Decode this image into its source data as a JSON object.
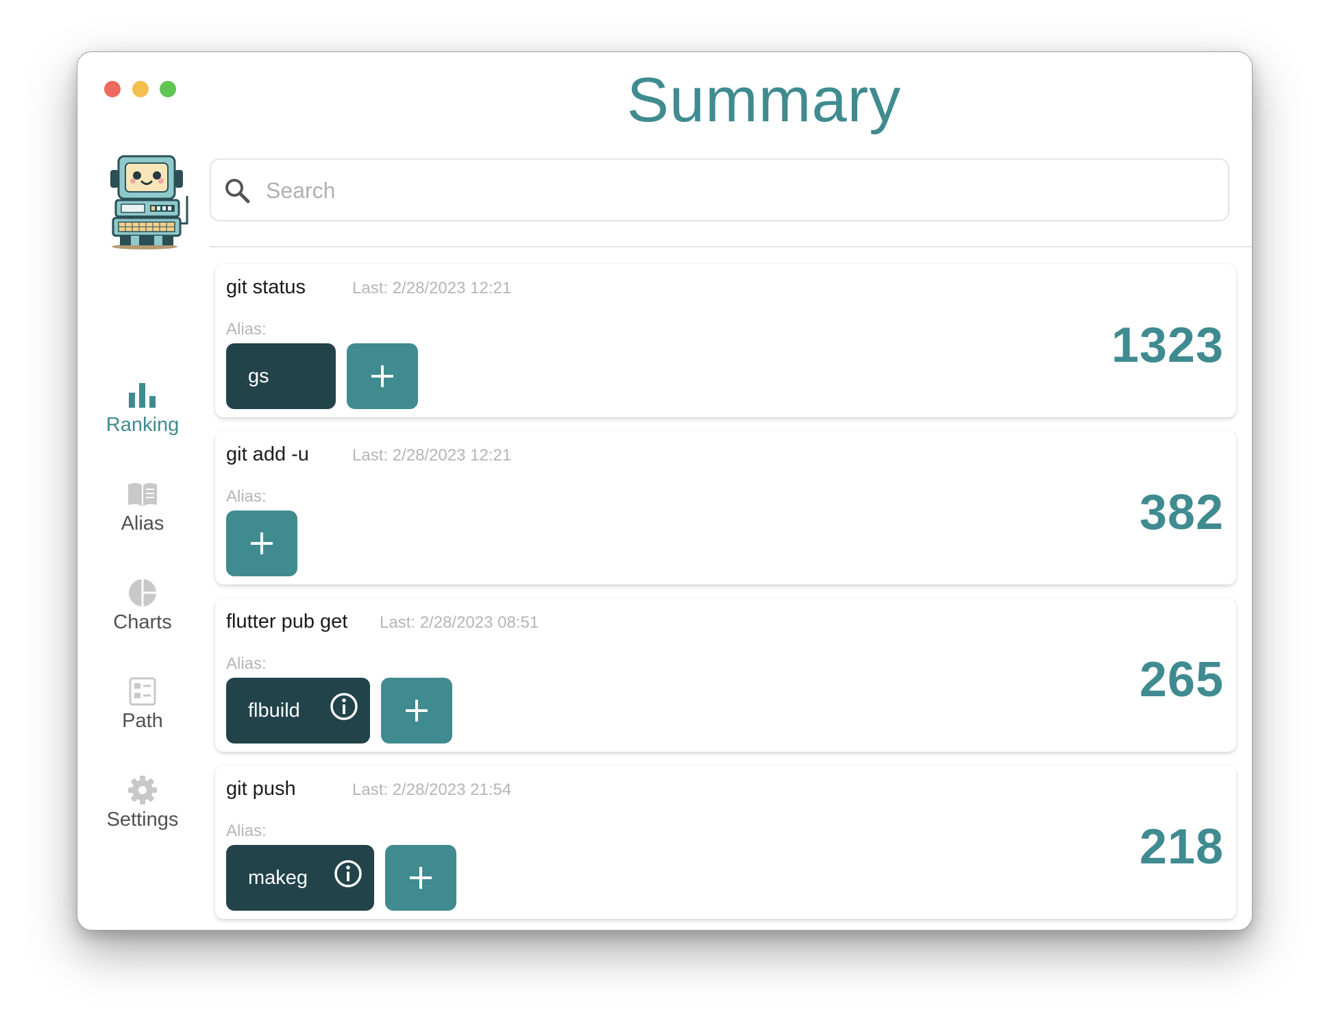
{
  "window": {
    "title": "Summary"
  },
  "sidebar": {
    "items": [
      {
        "label": "Ranking",
        "icon": "bar-chart-icon",
        "active": true
      },
      {
        "label": "Alias",
        "icon": "book-icon",
        "active": false
      },
      {
        "label": "Charts",
        "icon": "pie-chart-icon",
        "active": false
      },
      {
        "label": "Path",
        "icon": "list-panel-icon",
        "active": false
      },
      {
        "label": "Settings",
        "icon": "gear-icon",
        "active": false
      }
    ]
  },
  "search": {
    "placeholder": "Search",
    "value": ""
  },
  "commands": [
    {
      "command": "git status",
      "last": "Last: 2/28/2023 12:21",
      "alias_label": "Alias:",
      "aliases": [
        {
          "name": "gs",
          "info": false
        }
      ],
      "count": "1323"
    },
    {
      "command": "git add -u",
      "last": "Last: 2/28/2023 12:21",
      "alias_label": "Alias:",
      "aliases": [],
      "count": "382"
    },
    {
      "command": "flutter pub get",
      "last": "Last: 2/28/2023 08:51",
      "alias_label": "Alias:",
      "aliases": [
        {
          "name": "flbuild",
          "info": true
        }
      ],
      "count": "265"
    },
    {
      "command": "git push",
      "last": "Last: 2/28/2023 21:54",
      "alias_label": "Alias:",
      "aliases": [
        {
          "name": "makeg",
          "info": true
        }
      ],
      "count": "218"
    }
  ],
  "colors": {
    "accent": "#3f8b90",
    "chip": "#22434a",
    "inactive_icon": "#c8c8c8"
  }
}
